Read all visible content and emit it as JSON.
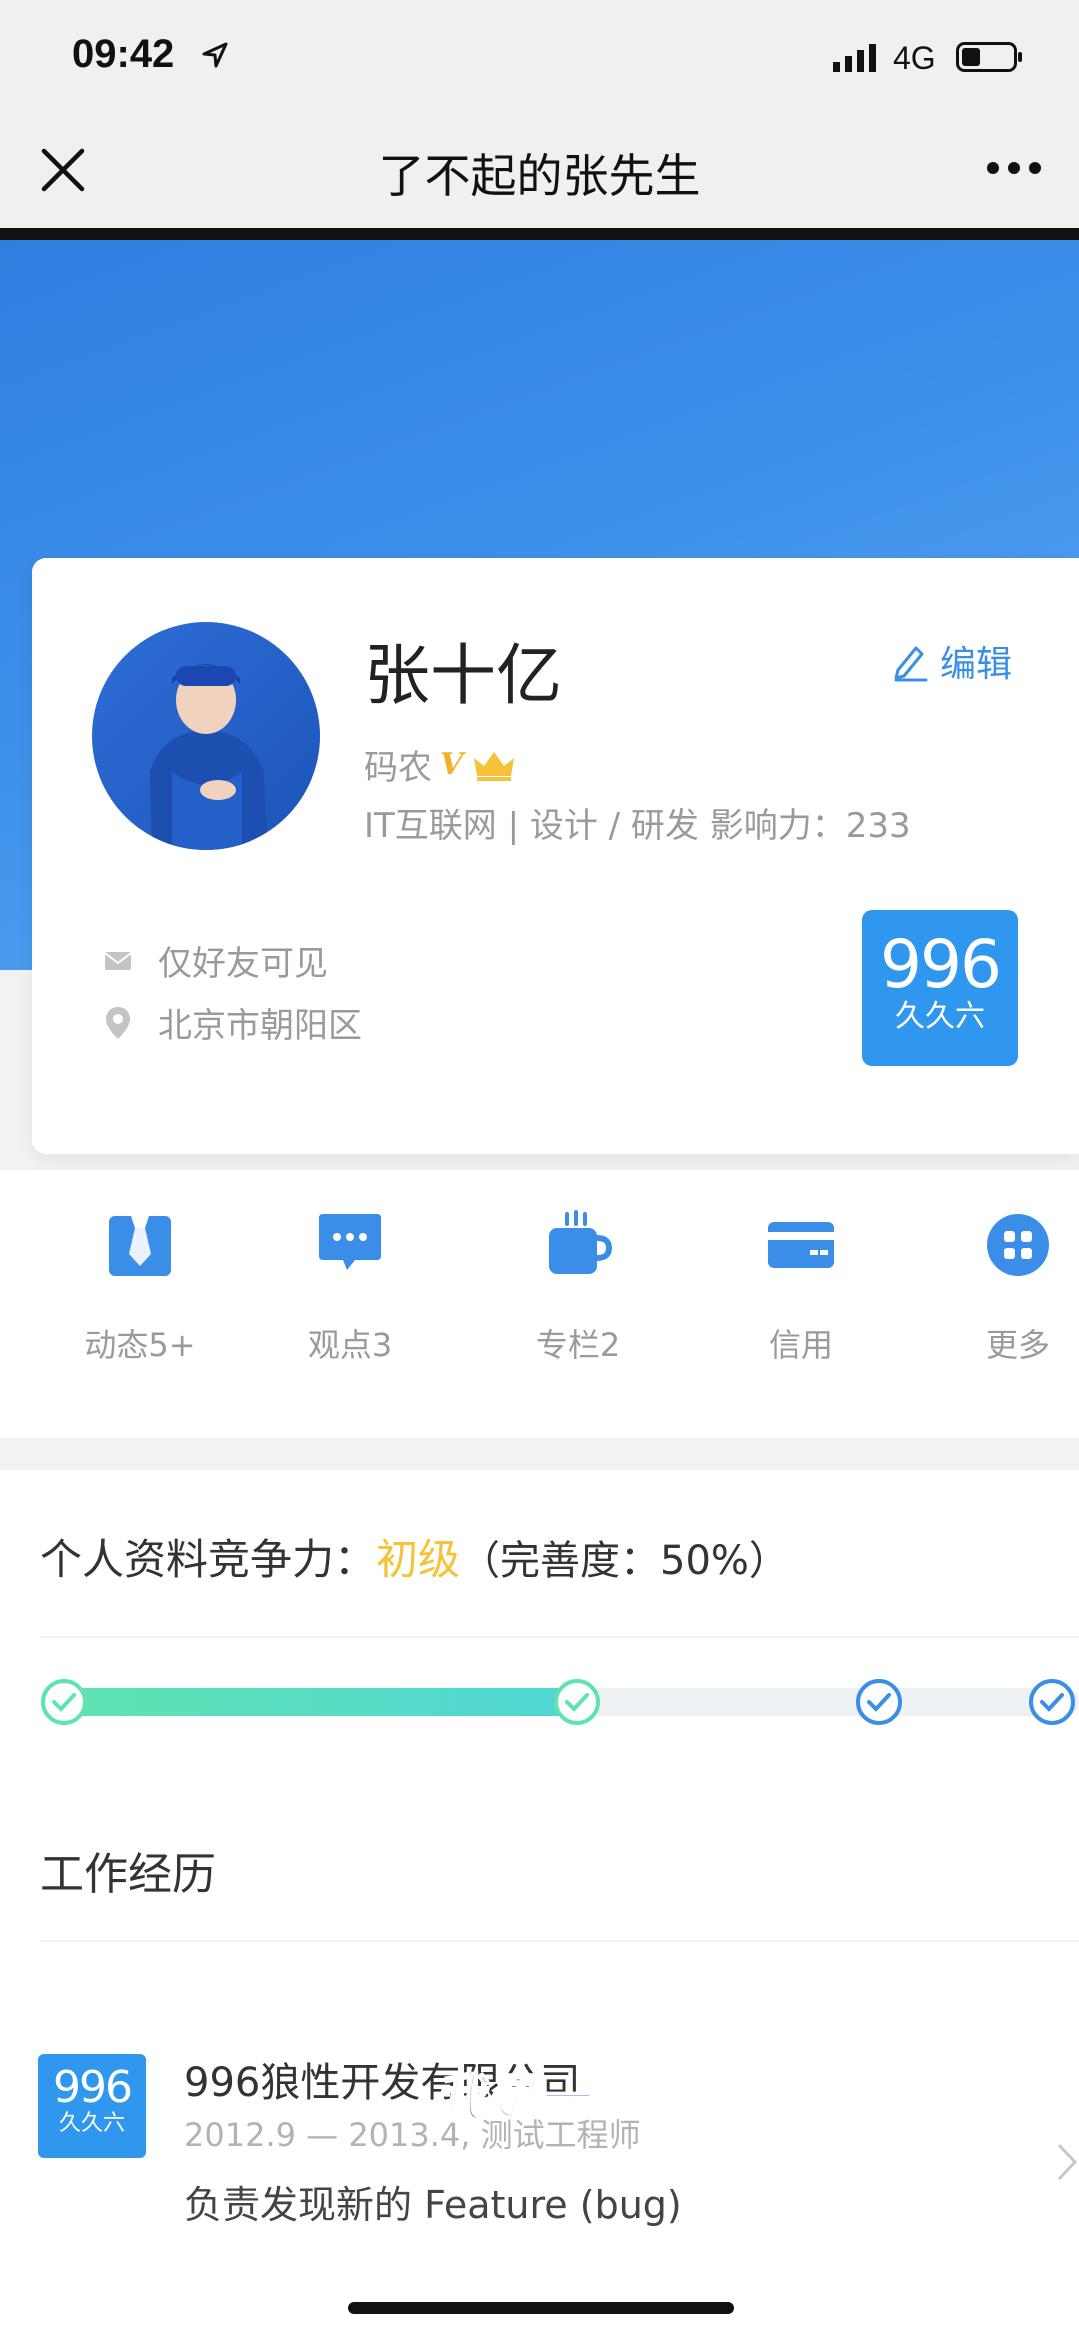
{
  "status_bar": {
    "time": "09:42",
    "network": "4G"
  },
  "nav": {
    "title": "了不起的张先生"
  },
  "profile": {
    "name": "张十亿",
    "edit_label": "编辑",
    "role": "码农",
    "vip_mark": "V",
    "info": "IT互联网 | 设计 / 研发  影响力：233",
    "privacy": "仅好友可见",
    "location": "北京市朝阳区",
    "logo_number": "996",
    "logo_sub": "久久六"
  },
  "actions": [
    {
      "label": "动态5+",
      "icon": "tie-icon"
    },
    {
      "label": "观点3",
      "icon": "chat-bubble-icon"
    },
    {
      "label": "专栏2",
      "icon": "mug-icon"
    },
    {
      "label": "信用",
      "icon": "credit-card-icon"
    },
    {
      "label": "更多",
      "icon": "more-grid-icon"
    }
  ],
  "competitiveness": {
    "label": "个人资料竞争力：",
    "level": "初级",
    "completeness": "（完善度：50%）",
    "progress": 0.5,
    "accent": "#f5c23a"
  },
  "work": {
    "title": "工作经历",
    "company": "996狼性开发有限公司",
    "period": "2012.9 — 2013.4, 测试工程师",
    "duty": "负责发现新的 Feature (bug)",
    "logo_number": "996",
    "logo_sub": "久久六"
  },
  "overlay_caption": "我是一零",
  "colors": {
    "brand_blue": "#3a8ee8",
    "badge_blue": "#2f97ee",
    "progress_green": "#5fe3b0"
  }
}
